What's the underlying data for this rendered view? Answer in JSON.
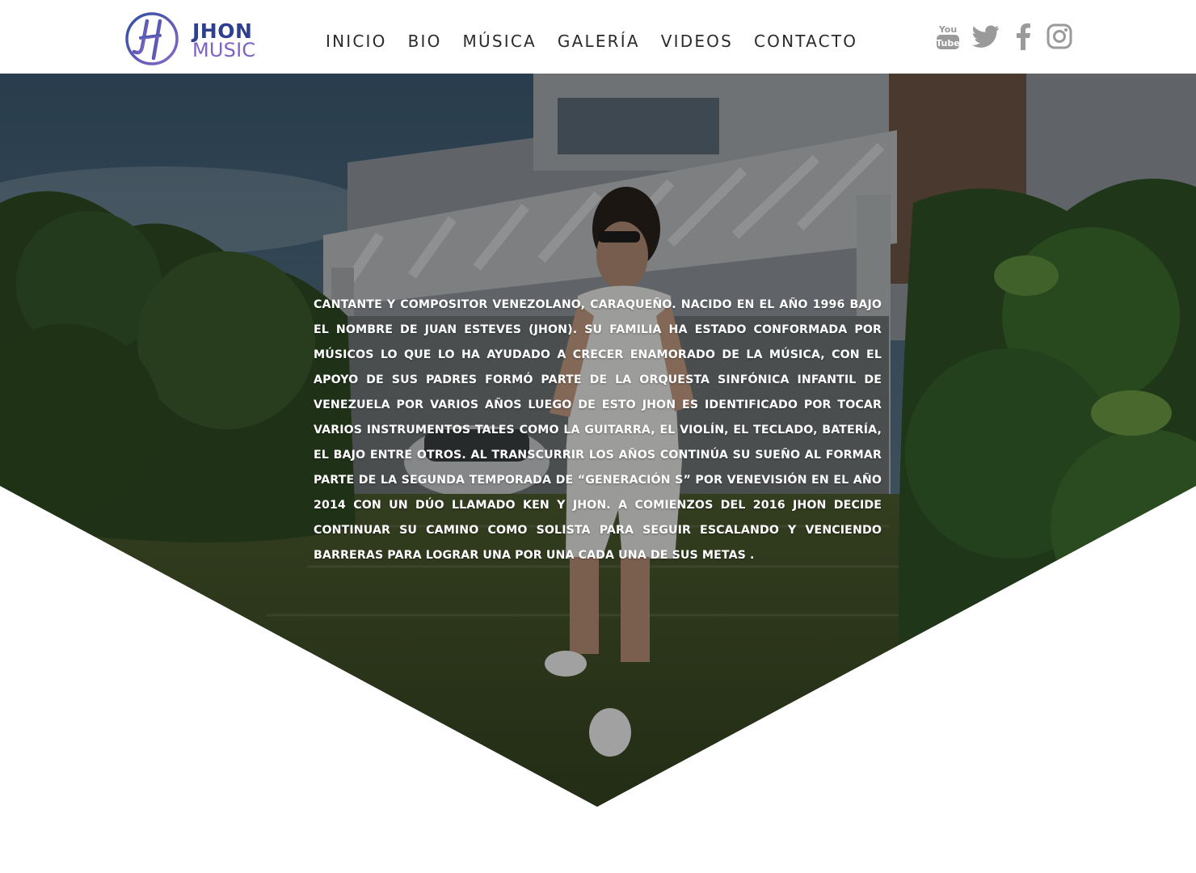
{
  "brand": {
    "line1": "JHON",
    "line2": "MUSIC",
    "mark_letters": "JH",
    "colors": {
      "primary": "#2f3f8f",
      "secondary": "#7e62c4"
    }
  },
  "nav": {
    "items": [
      {
        "label": "INICIO"
      },
      {
        "label": "BIO"
      },
      {
        "label": "MÚSICA"
      },
      {
        "label": "GALERÍA"
      },
      {
        "label": "VIDEOS"
      },
      {
        "label": "CONTACTO"
      }
    ]
  },
  "social": {
    "icon_color": "#9a9a9a",
    "icons": [
      "youtube-icon",
      "twitter-icon",
      "facebook-icon",
      "instagram-icon"
    ],
    "youtube_label_top": "You",
    "youtube_label_bottom": "Tube"
  },
  "hero": {
    "bio": "Cantante y compositor venezolano, caraqueño. Nacido en el año 1996 bajo el nombre de Juan Esteves (Jhon). Su familia ha estado conformada por músicos lo que lo ha ayudado a crecer enamorado de la música, con el apoyo de sus padres formó parte de la Orquesta Sinfónica Infantil de Venezuela por varios años luego de esto Jhon es identificado por tocar varios instrumentos tales como la guitarra, el violín, el teclado, batería, el bajo entre otros. Al transcurrir los años continúa su sueño al formar parte de la segunda temporada de “Generación S” por Venevisión en el año 2014 con un dúo llamado Ken y Jhon. A comienzos del 2016 Jhon decide continuar su camino como solista para seguir escalando y venciendo barreras para lograr una por una cada una de sus metas ."
  }
}
